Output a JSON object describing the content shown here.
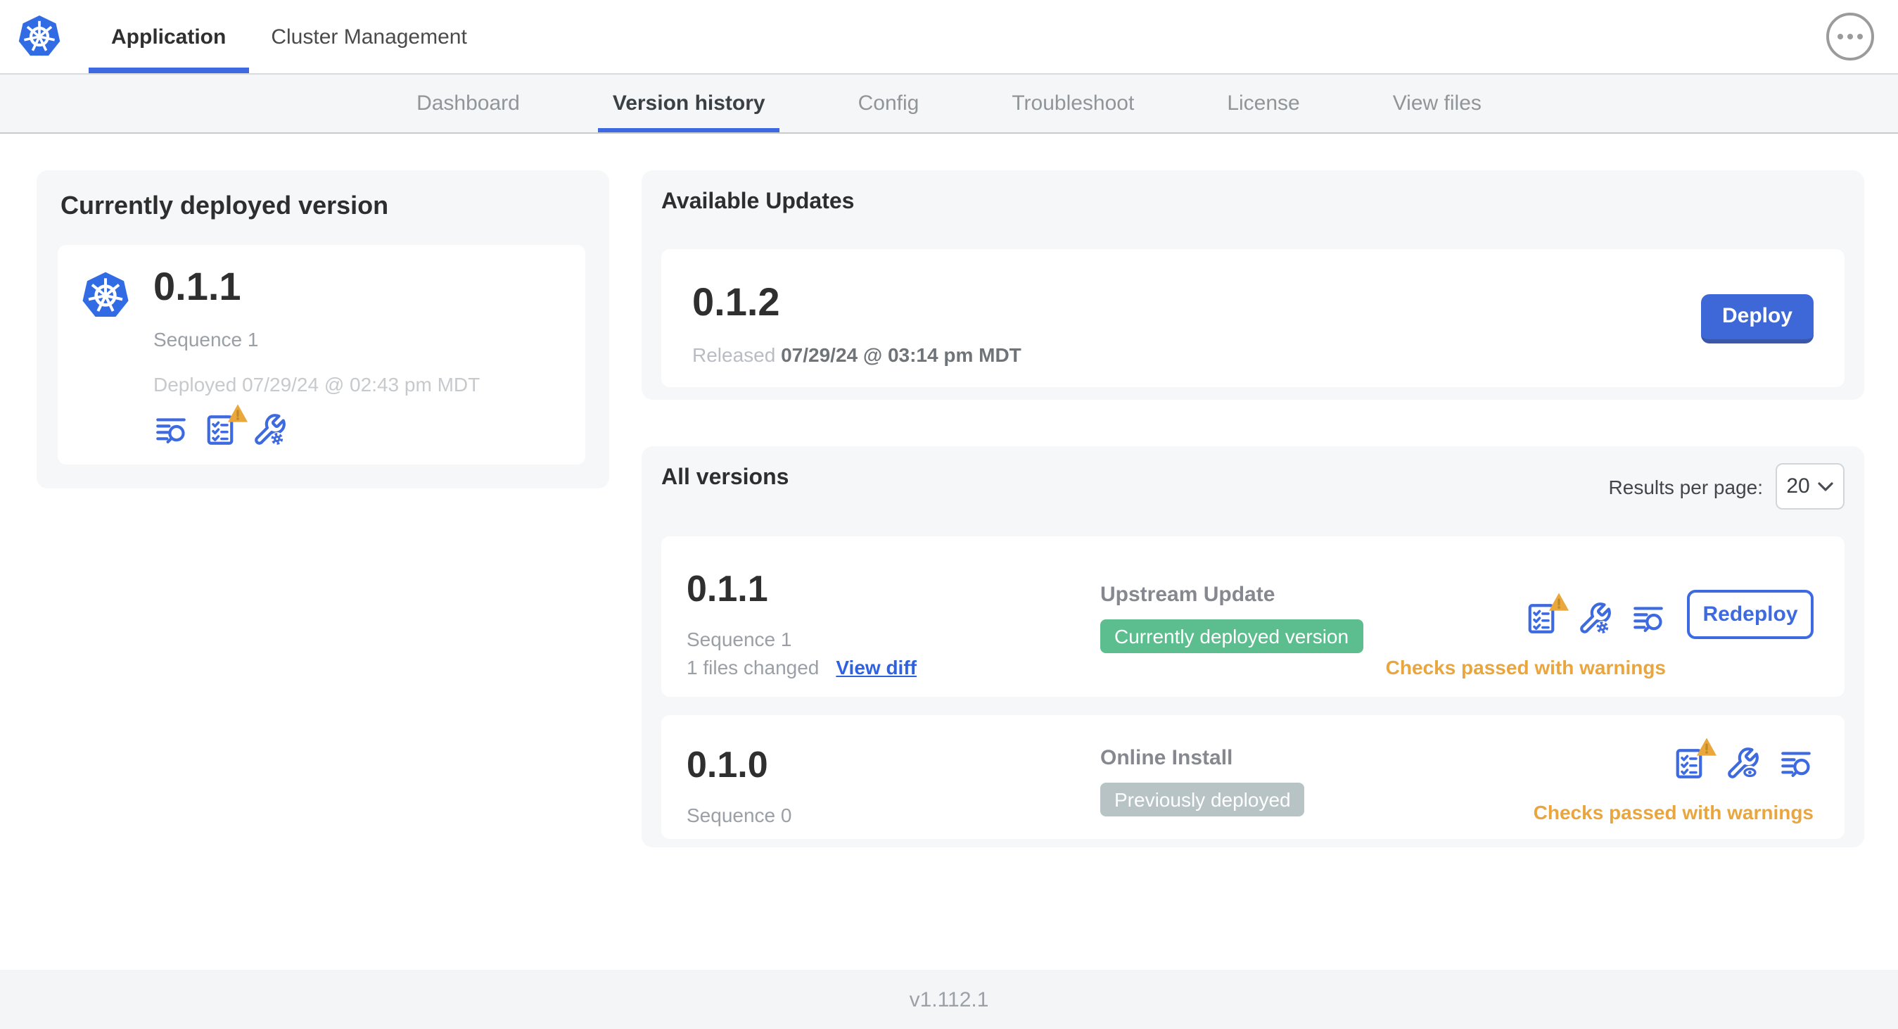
{
  "topnav": {
    "tabs": [
      {
        "label": "Application",
        "active": true
      },
      {
        "label": "Cluster Management",
        "active": false
      }
    ]
  },
  "subnav": {
    "tabs": [
      {
        "label": "Dashboard",
        "active": false
      },
      {
        "label": "Version history",
        "active": true
      },
      {
        "label": "Config",
        "active": false
      },
      {
        "label": "Troubleshoot",
        "active": false
      },
      {
        "label": "License",
        "active": false
      },
      {
        "label": "View files",
        "active": false
      }
    ]
  },
  "current_version": {
    "title": "Currently deployed version",
    "version": "0.1.1",
    "sequence": "Sequence 1",
    "deployed": "Deployed 07/29/24 @ 02:43 pm MDT"
  },
  "available_updates": {
    "title": "Available Updates",
    "version": "0.1.2",
    "released_prefix": "Released ",
    "released_date": "07/29/24 @ 03:14 pm MDT",
    "deploy_label": "Deploy"
  },
  "all_versions": {
    "title": "All versions",
    "results_per_page_label": "Results per page:",
    "results_per_page_value": "20",
    "rows": [
      {
        "version": "0.1.1",
        "sequence": "Sequence 1",
        "files_changed": "1 files changed",
        "view_diff_label": "View diff",
        "source": "Upstream Update",
        "badge": "Currently deployed version",
        "badge_type": "green",
        "status": "Checks passed with warnings",
        "action_label": "Redeploy"
      },
      {
        "version": "0.1.0",
        "sequence": "Sequence 0",
        "source": "Online Install",
        "badge": "Previously deployed",
        "badge_type": "gray",
        "status": "Checks passed with warnings"
      }
    ]
  },
  "footer": {
    "app_version": "v1.112.1"
  },
  "colors": {
    "accent_blue": "#3e6ae1",
    "k8s_blue": "#326ce5",
    "green_badge": "#5cbe8e",
    "gray_badge": "#b7c3c5",
    "warning_orange": "#eaa63e",
    "panel_gray": "#f6f7f9"
  }
}
